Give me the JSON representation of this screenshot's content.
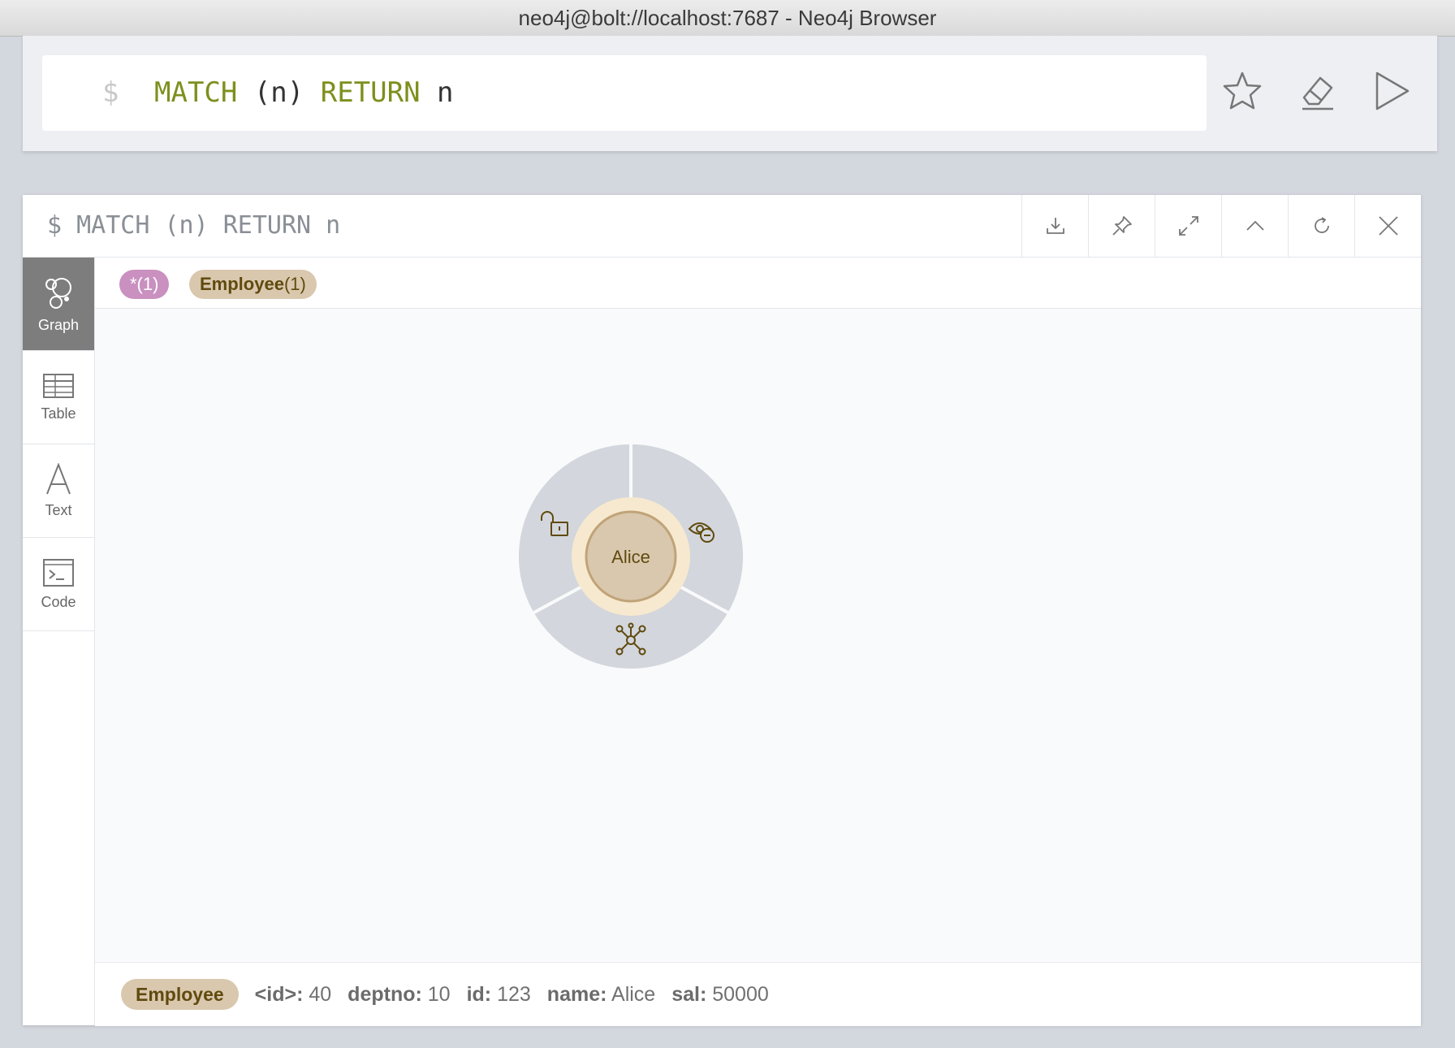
{
  "window": {
    "title": "neo4j@bolt://localhost:7687 - Neo4j Browser"
  },
  "editor": {
    "prompt": "$",
    "query_parts": [
      {
        "text": "MATCH",
        "kw": true
      },
      {
        "text": " (n) ",
        "kw": false
      },
      {
        "text": "RETURN",
        "kw": true
      },
      {
        "text": " n",
        "kw": false
      }
    ],
    "actions": [
      "star-icon",
      "eraser-icon",
      "play-icon"
    ]
  },
  "frame": {
    "title": "$ MATCH (n) RETURN n",
    "tools": [
      "download-icon",
      "pin-icon",
      "expand-icon",
      "collapse-icon",
      "rerun-icon",
      "close-icon"
    ],
    "views": [
      {
        "label": "Graph",
        "icon": "graph-icon",
        "active": true
      },
      {
        "label": "Table",
        "icon": "table-icon",
        "active": false
      },
      {
        "label": "Text",
        "icon": "text-icon",
        "active": false
      },
      {
        "label": "Code",
        "icon": "code-icon",
        "active": false
      }
    ],
    "legend": {
      "all": "*(1)",
      "label_name": "Employee",
      "label_count": "(1)"
    },
    "node": {
      "caption": "Alice",
      "menu": [
        "unlock-icon",
        "hide-icon",
        "expand-relationships-icon"
      ],
      "fill_color": "#d9c8ae",
      "stroke_color": "#c0a378",
      "halo_color": "#f7e9cf"
    },
    "details": {
      "label": "Employee",
      "props": [
        {
          "key": "<id>:",
          "value": "40"
        },
        {
          "key": "deptno:",
          "value": "10"
        },
        {
          "key": "id:",
          "value": "123"
        },
        {
          "key": "name:",
          "value": "Alice"
        },
        {
          "key": "sal:",
          "value": "50000"
        }
      ]
    }
  }
}
